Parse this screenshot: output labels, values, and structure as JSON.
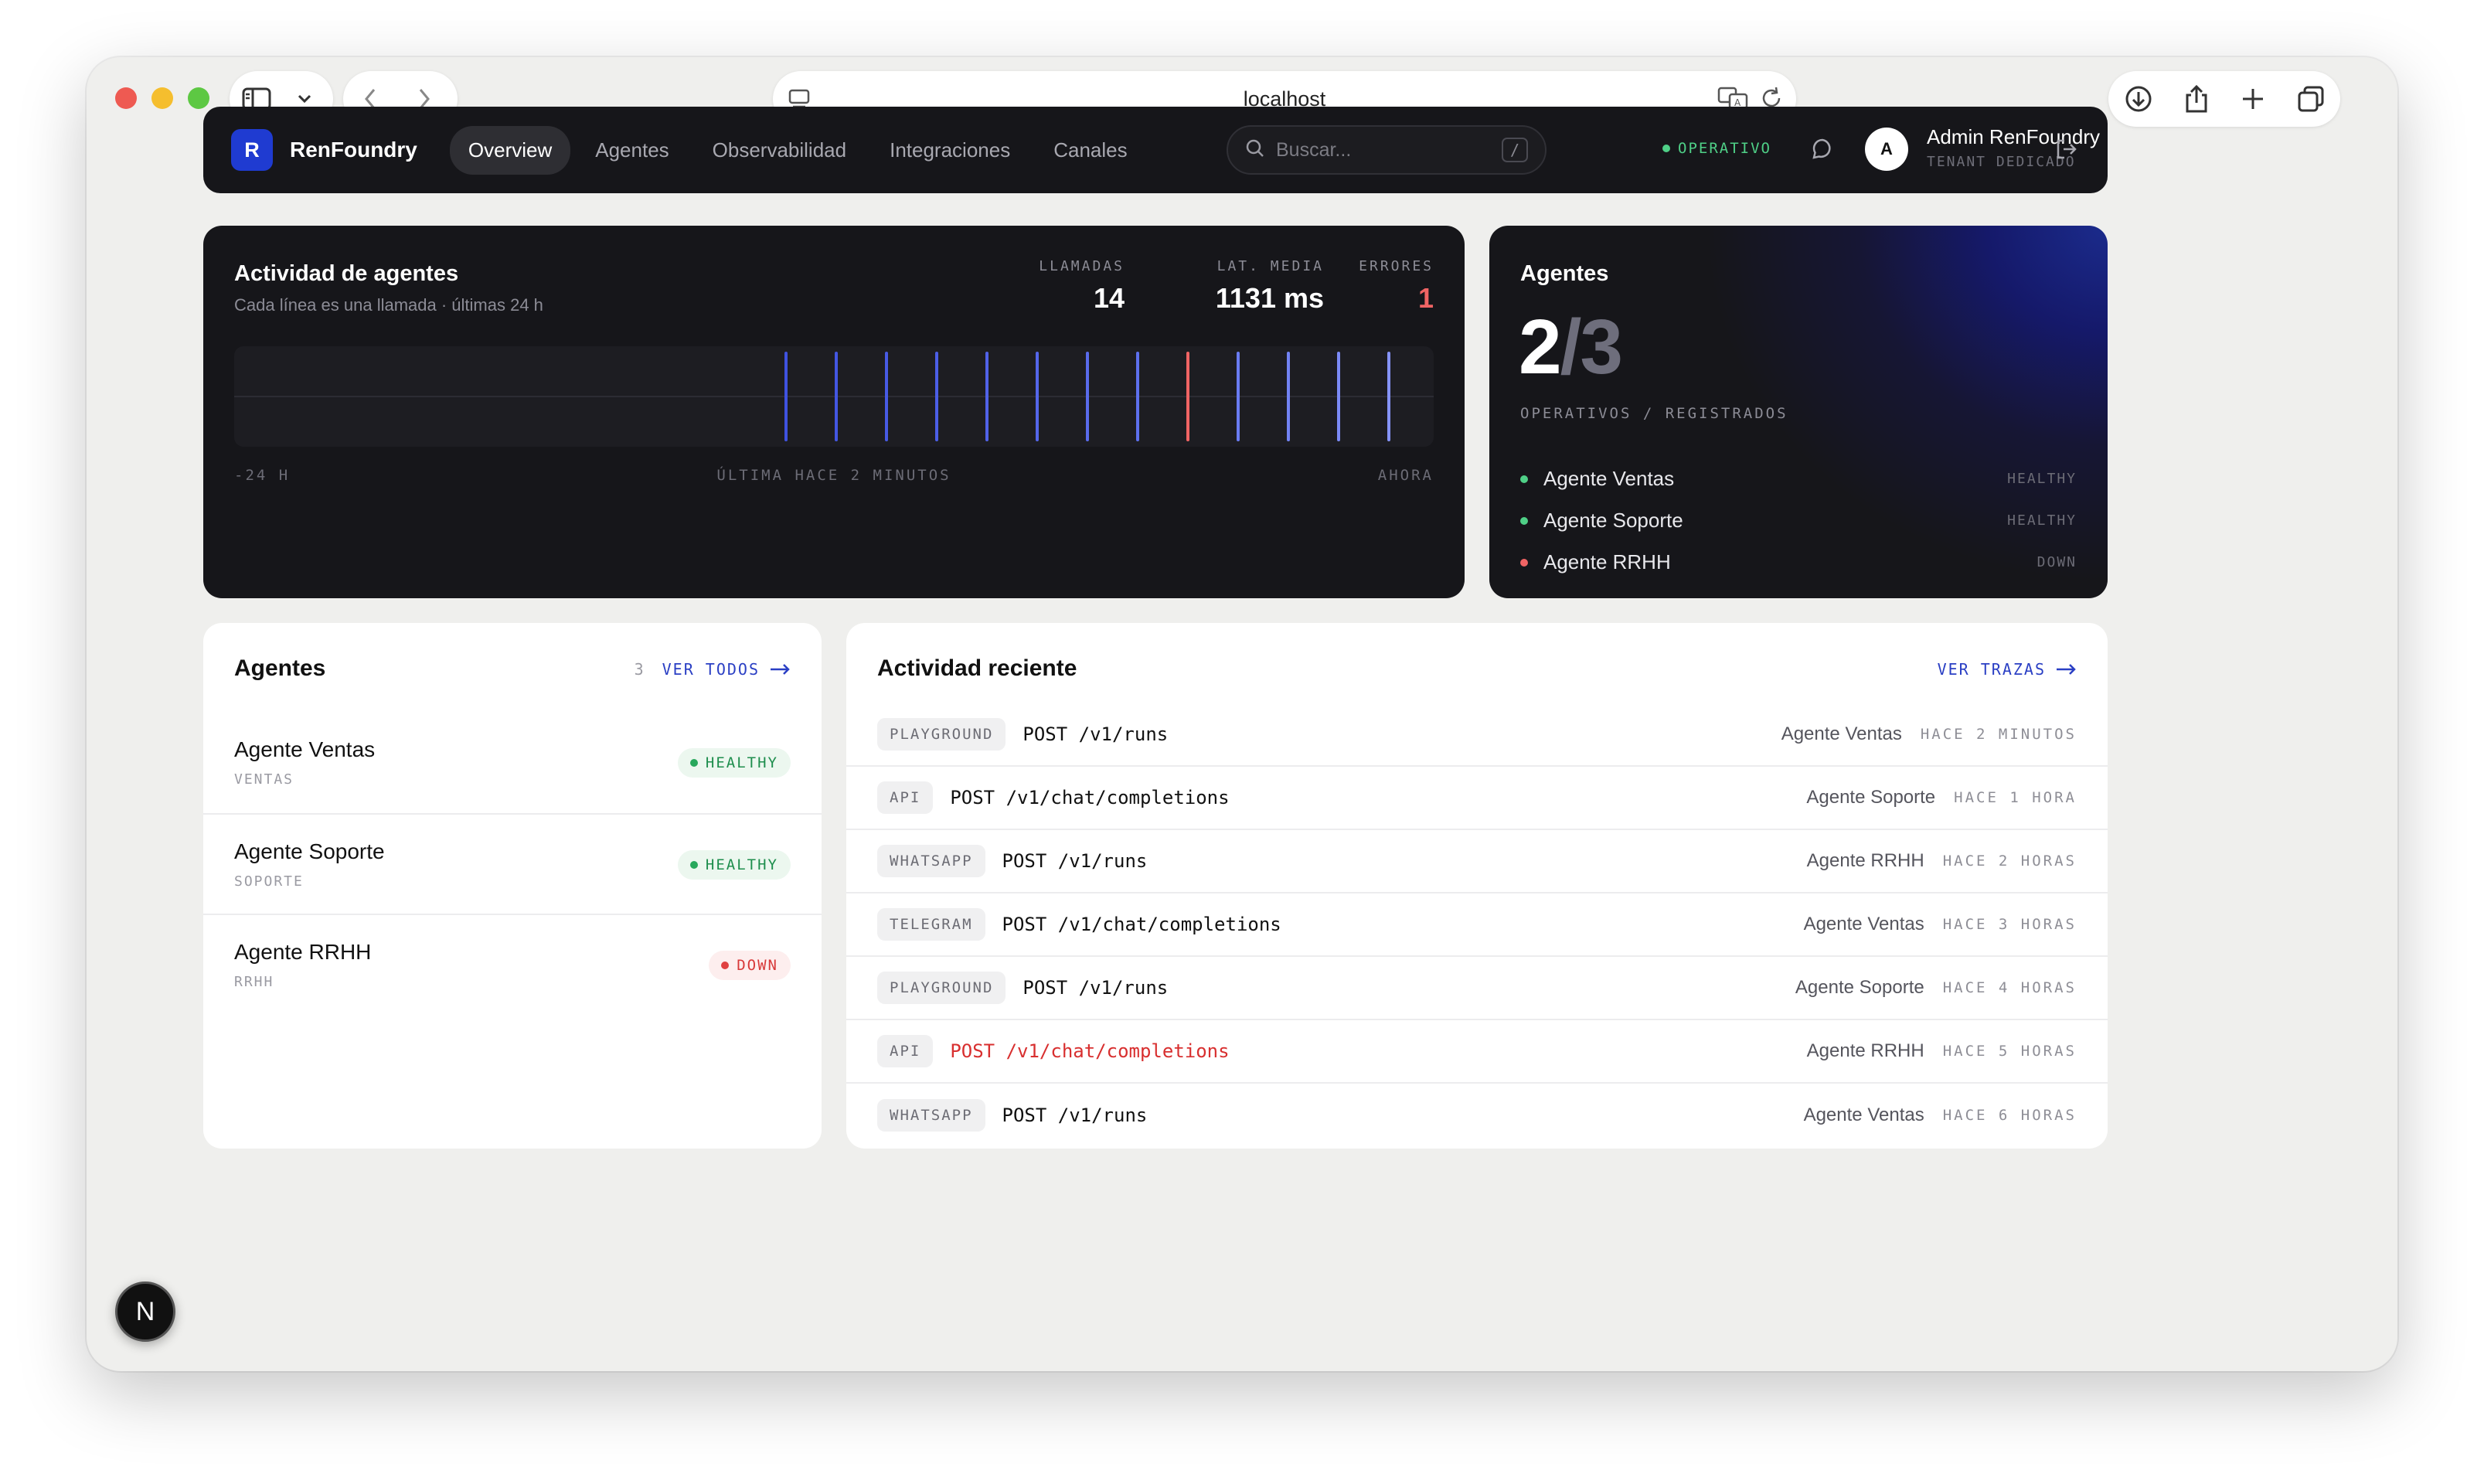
{
  "browser": {
    "url": "localhost",
    "icons": [
      "sidebar-icon",
      "chevron-down-icon",
      "back-icon",
      "forward-icon",
      "page-icon",
      "translate-icon",
      "reload-icon",
      "download-icon",
      "share-icon",
      "new-tab-icon",
      "tabs-icon"
    ]
  },
  "nav": {
    "logo_letter": "R",
    "brand": "RenFoundry",
    "links": [
      "Overview",
      "Agentes",
      "Observabilidad",
      "Integraciones",
      "Canales"
    ],
    "active_link": "Overview",
    "search_placeholder": "Buscar...",
    "search_shortcut": "/",
    "status": "OPERATIVO",
    "status_color": "#4fd087",
    "user_initial": "A",
    "user_name": "Admin RenFoundry",
    "user_role": "TENANT DEDICADO"
  },
  "activity": {
    "title": "Actividad de agentes",
    "subtitle": "Cada línea es una llamada · últimas 24 h",
    "stats": [
      {
        "label": "LLAMADAS",
        "value": "14"
      },
      {
        "label": "LAT. MEDIA",
        "value": "1131 ms"
      },
      {
        "label": "ERRORES",
        "value": "1"
      }
    ],
    "calls": [
      {
        "status": "ok",
        "color": "#3f52e0"
      },
      {
        "status": "ok",
        "color": "#4356e2"
      },
      {
        "status": "ok",
        "color": "#475ae4"
      },
      {
        "status": "ok",
        "color": "#4b5ee6"
      },
      {
        "status": "ok",
        "color": "#5062e8"
      },
      {
        "status": "ok",
        "color": "#5466ea"
      },
      {
        "status": "ok",
        "color": "#596bec"
      },
      {
        "status": "ok",
        "color": "#5d70ee"
      },
      {
        "status": "error",
        "color": "#f06464"
      },
      {
        "status": "ok",
        "color": "#6a7cf2"
      },
      {
        "status": "ok",
        "color": "#7283f4"
      },
      {
        "status": "ok",
        "color": "#7b8af6"
      },
      {
        "status": "ok",
        "color": "#8593f8"
      },
      {
        "status": "ok",
        "color": "#8f9cfa"
      }
    ],
    "axis_left": "-24 H",
    "axis_mid": "ÚLTIMA HACE 2 MINUTOS",
    "axis_right": "AHORA"
  },
  "agents_summary": {
    "title": "Agentes",
    "operational": "2",
    "registered": "3",
    "caption": "OPERATIVOS / REGISTRADOS",
    "items": [
      {
        "name": "Agente Ventas",
        "status": "HEALTHY",
        "color": "#4fd087"
      },
      {
        "name": "Agente Soporte",
        "status": "HEALTHY",
        "color": "#4fd087"
      },
      {
        "name": "Agente RRHH",
        "status": "DOWN",
        "color": "#f06464"
      }
    ]
  },
  "agents_list": {
    "title": "Agentes",
    "count": "3",
    "link": "VER TODOS",
    "items": [
      {
        "name": "Agente Ventas",
        "slug": "VENTAS",
        "status": "HEALTHY"
      },
      {
        "name": "Agente Soporte",
        "slug": "SOPORTE",
        "status": "HEALTHY"
      },
      {
        "name": "Agente RRHH",
        "slug": "RRHH",
        "status": "DOWN"
      }
    ]
  },
  "recent": {
    "title": "Actividad reciente",
    "link": "VER TRAZAS",
    "rows": [
      {
        "channel": "PLAYGROUND",
        "request": "POST /v1/runs",
        "agent": "Agente Ventas",
        "time": "HACE 2 MINUTOS",
        "error": false
      },
      {
        "channel": "API",
        "request": "POST /v1/chat/completions",
        "agent": "Agente Soporte",
        "time": "HACE 1 HORA",
        "error": false
      },
      {
        "channel": "WHATSAPP",
        "request": "POST /v1/runs",
        "agent": "Agente RRHH",
        "time": "HACE 2 HORAS",
        "error": false
      },
      {
        "channel": "TELEGRAM",
        "request": "POST /v1/chat/completions",
        "agent": "Agente Ventas",
        "time": "HACE 3 HORAS",
        "error": false
      },
      {
        "channel": "PLAYGROUND",
        "request": "POST /v1/runs",
        "agent": "Agente Soporte",
        "time": "HACE 4 HORAS",
        "error": false
      },
      {
        "channel": "API",
        "request": "POST /v1/chat/completions",
        "agent": "Agente RRHH",
        "time": "HACE 5 HORAS",
        "error": true
      },
      {
        "channel": "WHATSAPP",
        "request": "POST /v1/runs",
        "agent": "Agente Ventas",
        "time": "HACE 6 HORAS",
        "error": false
      }
    ]
  },
  "dev_badge": "N"
}
